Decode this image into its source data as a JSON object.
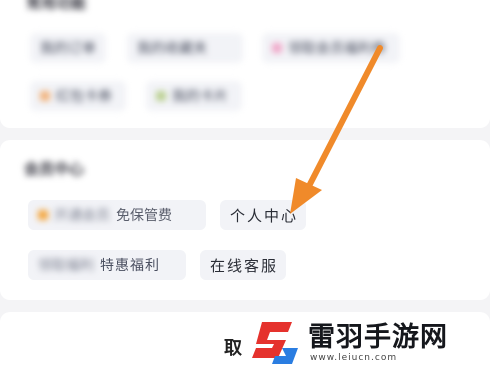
{
  "section_top": {
    "title": "常用功能",
    "chips": [
      {
        "label": "我的订单",
        "dot": ""
      },
      {
        "label": "我的收藏夹",
        "dot": ""
      },
      {
        "label": "领取会员福利券",
        "dot": "#f0a6c8"
      },
      {
        "label": "红包卡券",
        "dot": "#f2b27a"
      },
      {
        "label": "我的卡片",
        "dot": "#b9cf8e"
      }
    ]
  },
  "section_service": {
    "title": "会员中心",
    "chips": [
      {
        "label": "开通会员",
        "suffix": "免保管费",
        "dot": "#f4a43a"
      },
      {
        "label": "个人中心",
        "suffix": "",
        "dot": ""
      },
      {
        "label": "领取福利",
        "suffix": "特惠福利",
        "dot": ""
      },
      {
        "label": "在线客服",
        "suffix": "",
        "dot": ""
      }
    ]
  },
  "cancel_label": "取",
  "arrow_color": "#f08a2a",
  "watermark": {
    "title": "雷羽手游网",
    "url": "www.leiucn.com",
    "logo_red": "#e5322d",
    "logo_blue": "#2a7de1"
  }
}
